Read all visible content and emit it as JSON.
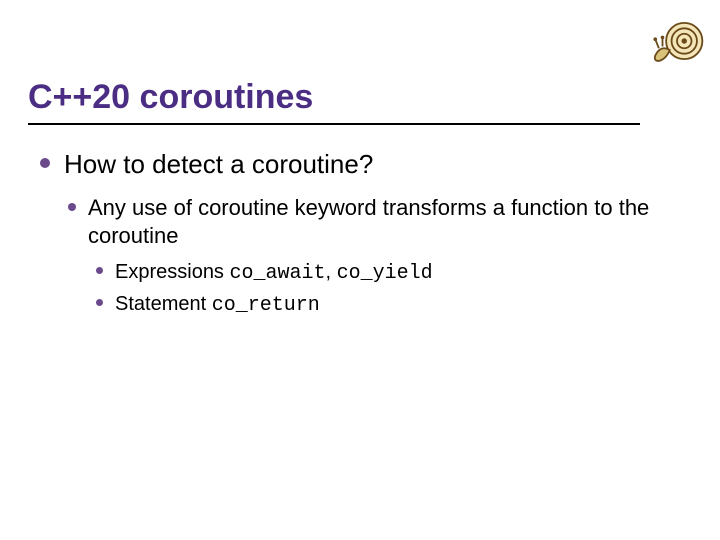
{
  "title": "C++20 coroutines",
  "bullets": {
    "l1": {
      "text": "How to detect a coroutine?"
    },
    "l2": {
      "text": "Any use of coroutine keyword transforms a function to the coroutine"
    },
    "l3a": {
      "prefix": "Expressions ",
      "code1": "co_await",
      "sep": ", ",
      "code2": "co_yield"
    },
    "l3b": {
      "prefix": "Statement ",
      "code1": "co_return"
    }
  }
}
